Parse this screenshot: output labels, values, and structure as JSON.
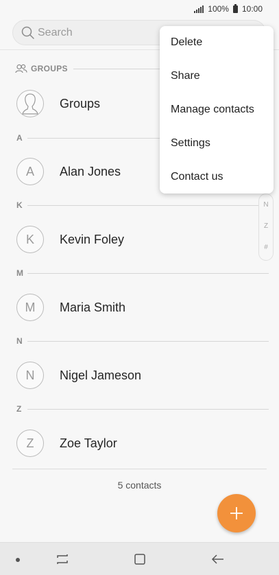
{
  "status_bar": {
    "battery": "100%",
    "time": "10:00"
  },
  "search": {
    "placeholder": "Search"
  },
  "groups": {
    "header": "GROUPS",
    "label": "Groups"
  },
  "sections": [
    {
      "letter": "A",
      "contacts": [
        {
          "initial": "A",
          "name": "Alan Jones"
        }
      ]
    },
    {
      "letter": "K",
      "contacts": [
        {
          "initial": "K",
          "name": "Kevin Foley"
        }
      ]
    },
    {
      "letter": "M",
      "contacts": [
        {
          "initial": "M",
          "name": "Maria Smith"
        }
      ]
    },
    {
      "letter": "N",
      "contacts": [
        {
          "initial": "N",
          "name": "Nigel Jameson"
        }
      ]
    },
    {
      "letter": "Z",
      "contacts": [
        {
          "initial": "Z",
          "name": "Zoe Taylor"
        }
      ]
    }
  ],
  "index_scroller": {
    "visible_letters": [
      "N",
      "Z",
      "#"
    ]
  },
  "footer": {
    "contact_count": "5 contacts"
  },
  "menu": {
    "items": [
      "Delete",
      "Share",
      "Manage contacts",
      "Settings",
      "Contact us"
    ]
  },
  "fab": {
    "icon": "plus-icon",
    "color": "#f2913b"
  },
  "navigation": {
    "icons": [
      "dot-icon",
      "recent-apps-icon",
      "home-icon",
      "back-icon"
    ]
  }
}
